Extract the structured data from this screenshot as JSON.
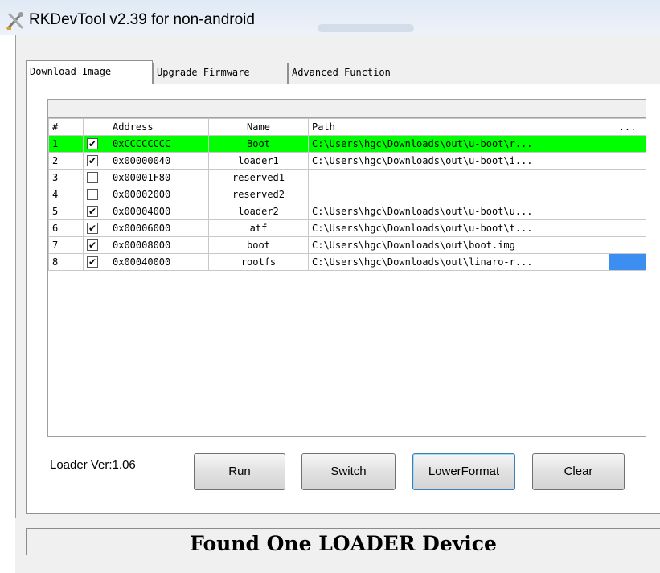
{
  "window": {
    "title": "RKDevTool v2.39 for non-android",
    "icon": "crossed-tools-icon"
  },
  "tabs": [
    {
      "label": "Download Image",
      "active": true
    },
    {
      "label": "Upgrade Firmware",
      "active": false
    },
    {
      "label": "Advanced Function",
      "active": false
    }
  ],
  "table": {
    "columns": [
      "#",
      "",
      "Address",
      "Name",
      "Path",
      "..."
    ],
    "rows": [
      {
        "num": "1",
        "checked": true,
        "address": "0xCCCCCCCC",
        "name": "Boot",
        "path": "C:\\Users\\hgc\\Downloads\\out\\u-boot\\r...",
        "selected": true
      },
      {
        "num": "2",
        "checked": true,
        "address": "0x00000040",
        "name": "loader1",
        "path": "C:\\Users\\hgc\\Downloads\\out\\u-boot\\i..."
      },
      {
        "num": "3",
        "checked": false,
        "address": "0x00001F80",
        "name": "reserved1",
        "path": ""
      },
      {
        "num": "4",
        "checked": false,
        "address": "0x00002000",
        "name": "reserved2",
        "path": ""
      },
      {
        "num": "5",
        "checked": true,
        "address": "0x00004000",
        "name": "loader2",
        "path": "C:\\Users\\hgc\\Downloads\\out\\u-boot\\u..."
      },
      {
        "num": "6",
        "checked": true,
        "address": "0x00006000",
        "name": "atf",
        "path": "C:\\Users\\hgc\\Downloads\\out\\u-boot\\t..."
      },
      {
        "num": "7",
        "checked": true,
        "address": "0x00008000",
        "name": "boot",
        "path": "C:\\Users\\hgc\\Downloads\\out\\boot.img"
      },
      {
        "num": "8",
        "checked": true,
        "address": "0x00040000",
        "name": "rootfs",
        "path": "C:\\Users\\hgc\\Downloads\\out\\linaro-r...",
        "browse_highlight": true
      }
    ],
    "check_glyph": "✔"
  },
  "footer": {
    "loader_version": "Loader Ver:1.06",
    "buttons": {
      "run": "Run",
      "switch": "Switch",
      "lower_format": "LowerFormat",
      "clear": "Clear"
    }
  },
  "status": {
    "message": "Found One LOADER Device"
  },
  "colors": {
    "selected_row": "#00ff00",
    "browse_cell": "#3c8ff0"
  }
}
